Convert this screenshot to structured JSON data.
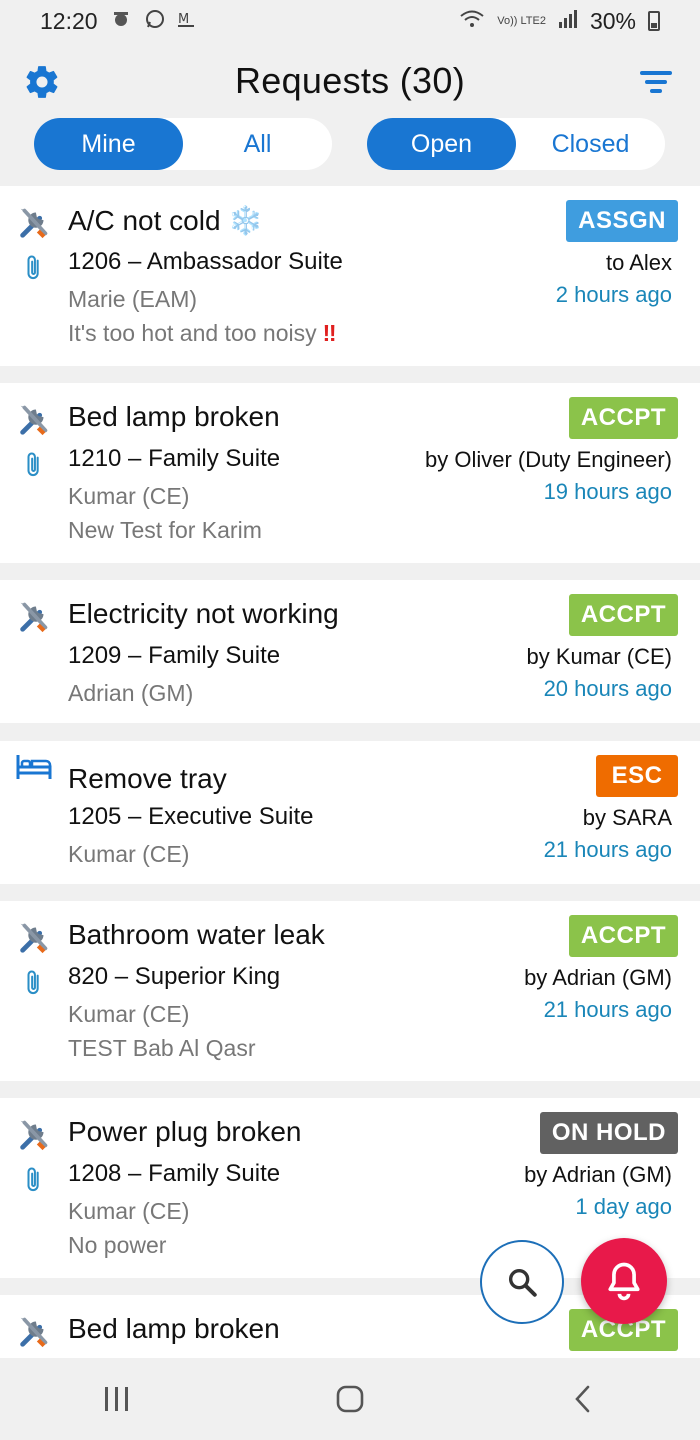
{
  "status": {
    "time": "12:20",
    "network": "Vo)) LTE2",
    "battery": "30%"
  },
  "header": {
    "title": "Requests (30)"
  },
  "segments": {
    "owner": [
      "Mine",
      "All"
    ],
    "state": [
      "Open",
      "Closed"
    ]
  },
  "colors": {
    "accent": "#1976d2",
    "assigned": "#3f9ddf",
    "accepted": "#8bc34a",
    "escalated": "#ef6c00",
    "on_hold": "#616161",
    "fab": "#e8194a"
  },
  "requests": [
    {
      "icon": "wrench-screwdriver-icon",
      "attachment": true,
      "title": "A/C not cold",
      "title_emoji": "❄️",
      "room": "1206 – Ambassador Suite",
      "reporter": "Marie (EAM)",
      "note": "It's too hot and too noisy",
      "note_flag": "‼",
      "status": "ASSGN",
      "assignee": "to Alex",
      "time": "2 hours ago"
    },
    {
      "icon": "wrench-screwdriver-icon",
      "attachment": true,
      "title": "Bed lamp broken",
      "room": "1210 – Family Suite",
      "reporter": "Kumar (CE)",
      "note": "New Test for Karim",
      "status": "ACCPT",
      "assignee": "by Oliver (Duty Engineer)",
      "time": "19 hours ago"
    },
    {
      "icon": "wrench-screwdriver-icon",
      "attachment": false,
      "title": "Electricity not working",
      "room": "1209 – Family Suite",
      "reporter": "Adrian (GM)",
      "status": "ACCPT",
      "assignee": "by Kumar (CE)",
      "time": "20 hours ago"
    },
    {
      "icon": "bed-icon",
      "attachment": false,
      "title": "Remove tray",
      "room": "1205 – Executive Suite",
      "reporter": "Kumar (CE)",
      "status": "ESC",
      "assignee": "by SARA",
      "time": "21 hours ago"
    },
    {
      "icon": "wrench-screwdriver-icon",
      "attachment": true,
      "title": "Bathroom water leak",
      "room": "820 – Superior King",
      "reporter": "Kumar (CE)",
      "note": "TEST Bab Al Qasr",
      "status": "ACCPT",
      "assignee": "by Adrian (GM)",
      "time": "21 hours ago"
    },
    {
      "icon": "wrench-screwdriver-icon",
      "attachment": true,
      "title": "Power plug broken",
      "room": "1208 – Family Suite",
      "reporter": "Kumar (CE)",
      "note": "No power",
      "status": "ON HOLD",
      "assignee": "by Adrian (GM)",
      "time": "1 day ago"
    },
    {
      "icon": "wrench-screwdriver-icon",
      "attachment": false,
      "title": "Bed lamp broken",
      "status": "ACCPT"
    }
  ]
}
